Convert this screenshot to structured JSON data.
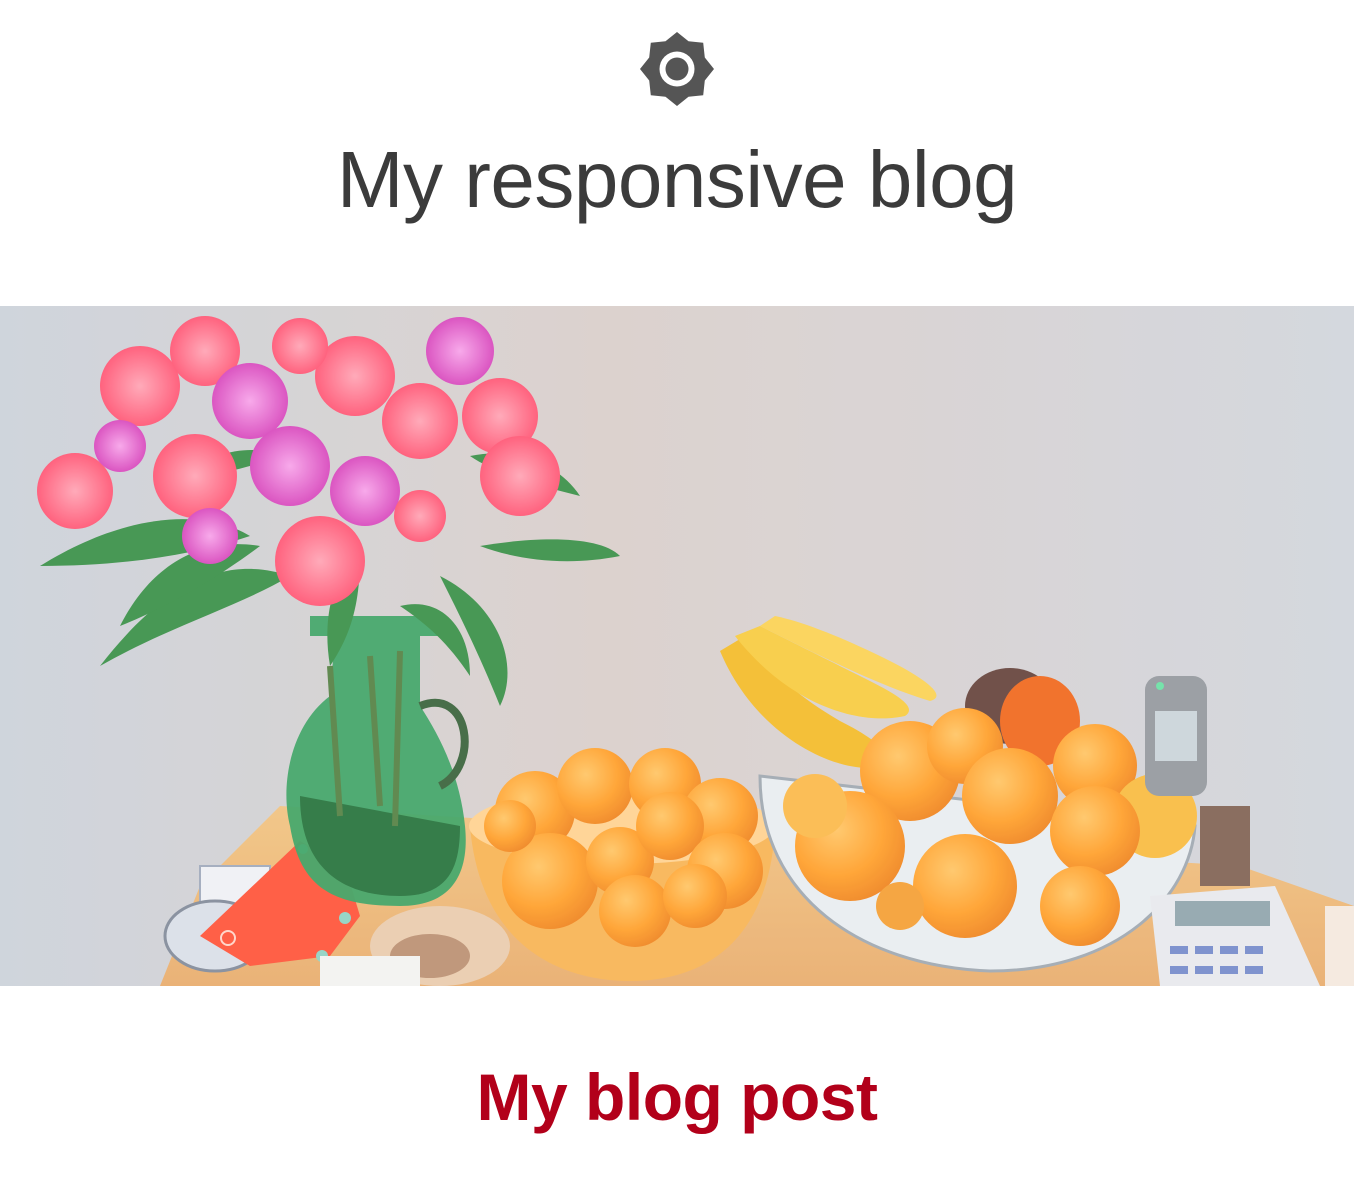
{
  "header": {
    "logo_icon": "sun-gear-icon",
    "site_title": "My responsive blog",
    "logo_color": "#555555",
    "title_color": "#3b3b3b"
  },
  "hero": {
    "icon": "still-life-photo"
  },
  "post": {
    "title": "My blog post",
    "title_color": "#b2001a"
  }
}
